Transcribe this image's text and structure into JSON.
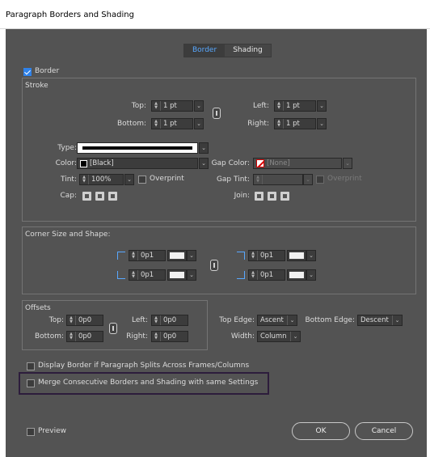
{
  "window": {
    "title": "Paragraph Borders and Shading"
  },
  "tabs": [
    {
      "label": "Border",
      "active": true
    },
    {
      "label": "Shading",
      "active": false
    }
  ],
  "border_toggle": {
    "label": "Border",
    "checked": true
  },
  "stroke": {
    "title": "Stroke",
    "top_label": "Top:",
    "top_value": "1 pt",
    "bottom_label": "Bottom:",
    "bottom_value": "1 pt",
    "left_label": "Left:",
    "left_value": "1 pt",
    "right_label": "Right:",
    "right_value": "1 pt",
    "type_label": "Type:",
    "color_label": "Color:",
    "color_value": "[Black]",
    "gap_color_label": "Gap Color:",
    "gap_color_value": "[None]",
    "tint_label": "Tint:",
    "tint_value": "100%",
    "overprint_label": "Overprint",
    "gap_tint_label": "Gap Tint:",
    "gap_overprint_label": "Overprint",
    "cap_label": "Cap:",
    "join_label": "Join:"
  },
  "corner": {
    "title": "Corner Size and Shape:",
    "top_left_value": "0p1",
    "bottom_left_value": "0p1",
    "top_right_value": "0p1",
    "bottom_right_value": "0p1"
  },
  "offsets": {
    "title": "Offsets",
    "top_label": "Top:",
    "top_value": "0p0",
    "bottom_label": "Bottom:",
    "bottom_value": "0p0",
    "left_label": "Left:",
    "left_value": "0p0",
    "right_label": "Right:",
    "right_value": "0p0",
    "top_edge_label": "Top Edge:",
    "top_edge_value": "Ascent",
    "bottom_edge_label": "Bottom Edge:",
    "bottom_edge_value": "Descent",
    "width_label": "Width:",
    "width_value": "Column"
  },
  "options": {
    "display_split_label": "Display Border if Paragraph Splits Across Frames/Columns",
    "merge_label": "Merge Consecutive Borders and Shading with same Settings"
  },
  "footer": {
    "preview_label": "Preview",
    "ok_label": "OK",
    "cancel_label": "Cancel"
  },
  "colors": {
    "accent": "#2f82ea",
    "panel": "#535353",
    "highlight_border": "#2d1d3c"
  }
}
